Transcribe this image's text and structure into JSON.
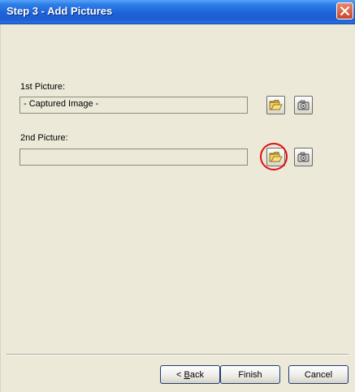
{
  "window": {
    "title": "Step 3 - Add Pictures",
    "close_icon": "close-icon"
  },
  "pictures": [
    {
      "label": "1st Picture:",
      "value": "- Captured Image -",
      "browse_icon": "open-folder-icon",
      "capture_icon": "camera-icon"
    },
    {
      "label": "2nd Picture:",
      "value": "",
      "browse_icon": "open-folder-icon",
      "capture_icon": "camera-icon"
    }
  ],
  "buttons": {
    "back_prefix": "< ",
    "back_mnemonic": "B",
    "back_rest": "ack",
    "finish": "Finish",
    "cancel": "Cancel"
  },
  "colors": {
    "title_bar": "#1c63d8",
    "dialog_bg": "#ece9d8",
    "highlight": "#e01010"
  }
}
